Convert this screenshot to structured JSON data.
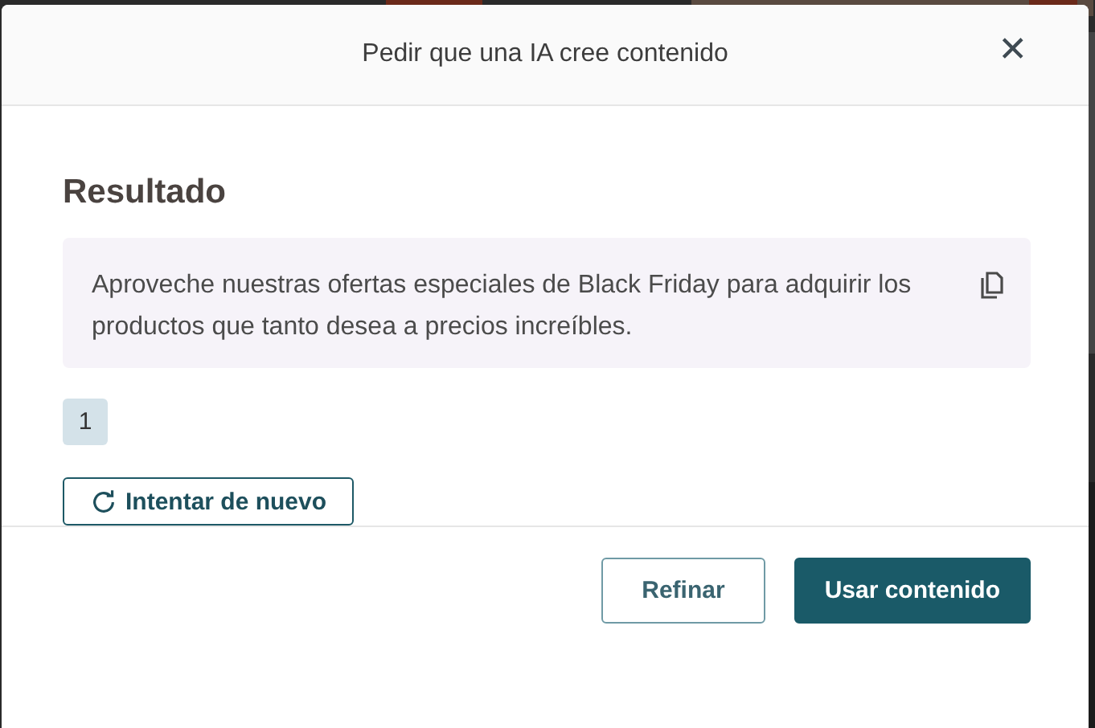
{
  "dialog": {
    "title": "Pedir que una IA cree contenido",
    "close_icon": "✕"
  },
  "result": {
    "heading": "Resultado",
    "text": "Aproveche nuestras ofertas especiales de Black Friday para adquirir los productos que tanto desea a precios increíbles.",
    "pages": [
      {
        "label": "1",
        "selected": true
      }
    ],
    "retry_button": "Intentar de nuevo"
  },
  "footer": {
    "buttons": [
      {
        "label": "Refinar",
        "kind": "secondary"
      },
      {
        "label": "Usar contenido",
        "kind": "primary"
      }
    ]
  }
}
